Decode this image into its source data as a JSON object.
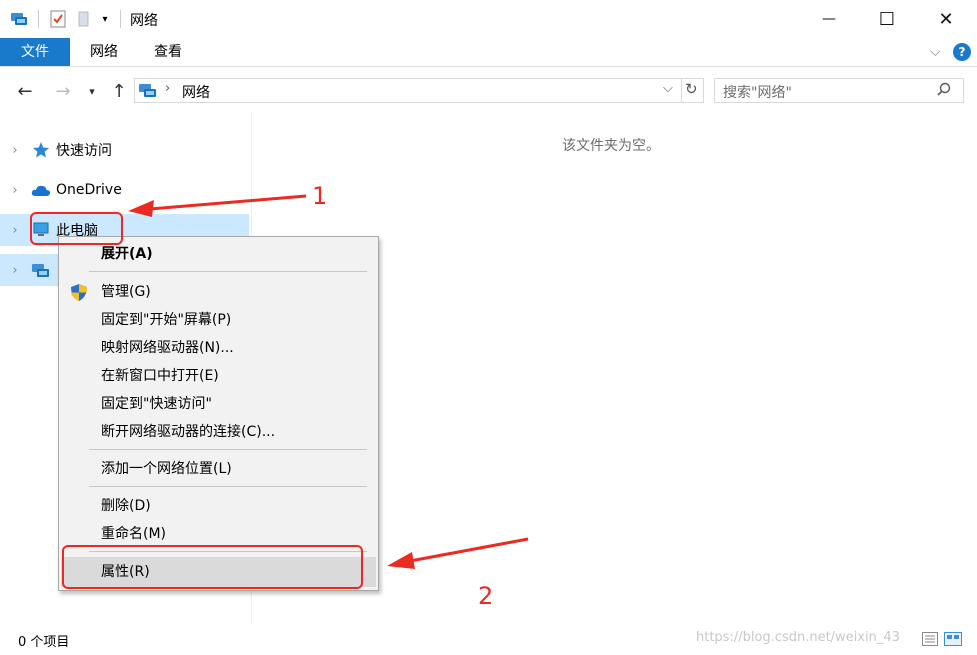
{
  "window": {
    "title": "网络",
    "minimize": "—",
    "maximize": "☐",
    "close": "✕"
  },
  "ribbon": {
    "tabs": [
      "文件",
      "网络",
      "查看"
    ],
    "help": "?"
  },
  "address": {
    "location": "网络",
    "search_placeholder": "搜索\"网络\""
  },
  "nav_pane": {
    "items": [
      {
        "label": "快速访问",
        "icon": "star-icon"
      },
      {
        "label": "OneDrive",
        "icon": "cloud-icon"
      },
      {
        "label": "此电脑",
        "icon": "computer-icon",
        "selected": true
      },
      {
        "label": "",
        "icon": "network-icon",
        "selected": true
      }
    ]
  },
  "content": {
    "empty_message": "该文件夹为空。"
  },
  "status": {
    "item_count": "0 个项目"
  },
  "context_menu": {
    "items": [
      {
        "label": "展开(A)",
        "bold": true
      },
      {
        "label": "管理(G)",
        "icon": "uac-shield-icon"
      },
      {
        "label": "固定到\"开始\"屏幕(P)"
      },
      {
        "label": "映射网络驱动器(N)..."
      },
      {
        "label": "在新窗口中打开(E)"
      },
      {
        "label": "固定到\"快速访问\""
      },
      {
        "label": "断开网络驱动器的连接(C)..."
      },
      {
        "label": "添加一个网络位置(L)"
      },
      {
        "label": "删除(D)"
      },
      {
        "label": "重命名(M)"
      },
      {
        "label": "属性(R)",
        "highlighted": true
      }
    ]
  },
  "annotations": {
    "label_1": "1",
    "label_2": "2",
    "color": "#ea2b1f"
  },
  "watermark": "https://blog.csdn.net/weixin_43"
}
